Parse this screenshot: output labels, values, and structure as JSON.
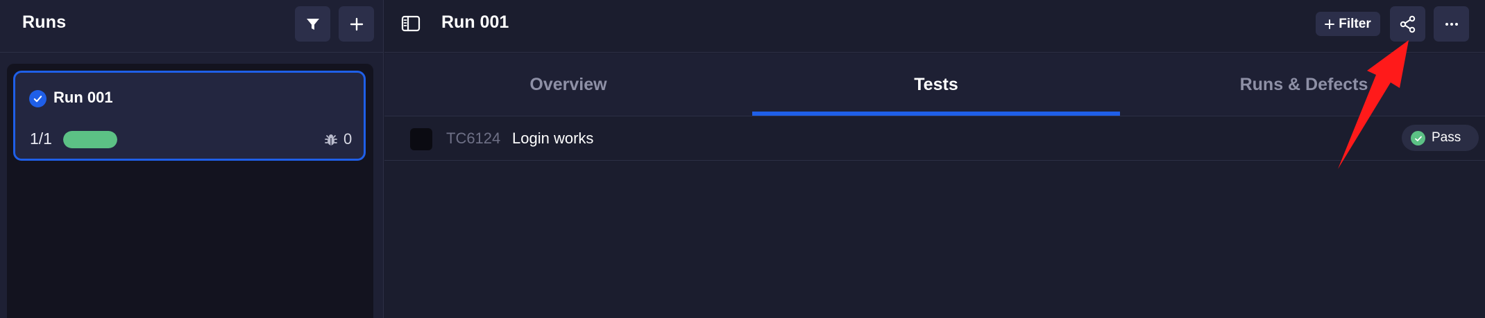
{
  "sidebar": {
    "title": "Runs",
    "filter_icon": "filter-icon",
    "add_icon": "plus-icon",
    "runs": [
      {
        "name": "Run 001",
        "status_icon": "check-circle-icon",
        "count": "1/1",
        "progress": 1.0,
        "defects": "0",
        "defect_icon": "bug-icon"
      }
    ]
  },
  "header": {
    "panel_icon": "sidebar-toggle-icon",
    "title": "Run 001",
    "filter_label": "Filter",
    "share_icon": "share-icon",
    "more_icon": "more-horizontal-icon"
  },
  "tabs": [
    {
      "label": "Overview",
      "active": false
    },
    {
      "label": "Tests",
      "active": true
    },
    {
      "label": "Runs & Defects",
      "active": false
    }
  ],
  "tests": [
    {
      "id": "TC6124",
      "title": "Login works",
      "status": "Pass"
    }
  ],
  "colors": {
    "accent": "#1f5fe8",
    "pass": "#5cc185",
    "annotation": "#ff1a1a"
  }
}
